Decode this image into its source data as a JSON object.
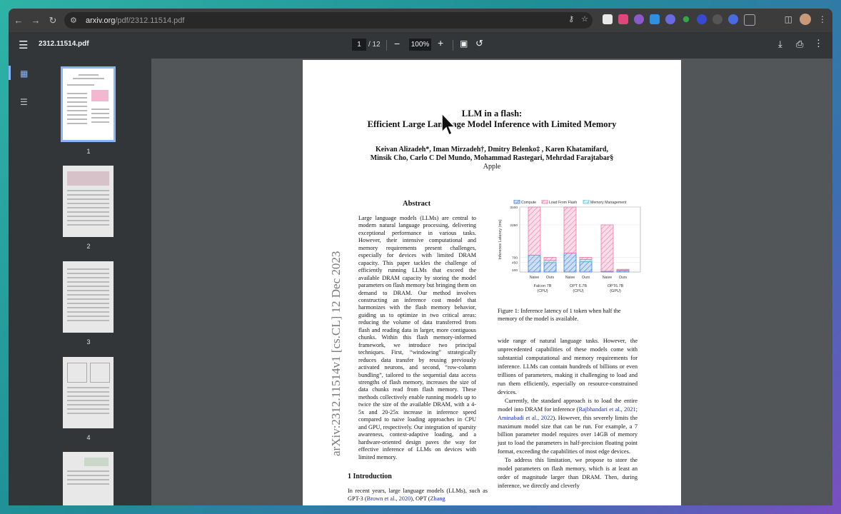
{
  "browser": {
    "url_host": "arxiv.org",
    "url_path": "/pdf/2312.11514.pdf",
    "back_icon": "arrow-left-icon",
    "forward_icon": "arrow-right-icon",
    "reload_icon": "reload-icon"
  },
  "toolbar": {
    "filename": "2312.11514.pdf",
    "page_current": "1",
    "page_total": "/ 12",
    "zoom": "100%"
  },
  "thumbnails": [
    "1",
    "2",
    "3",
    "4"
  ],
  "paper": {
    "title_1": "LLM in a flash:",
    "title_2": "Efficient Large Language Model Inference with Limited Memory",
    "authors_1": "Keivan Alizadeh*, Iman Mirzadeh†, Dmitry Belenko‡ , Karen Khatamifard,",
    "authors_2": "Minsik Cho, Carlo C Del Mundo, Mohammad Rastegari, Mehrdad Farajtabar§",
    "affiliation": "Apple",
    "arxiv_stamp": "arXiv:2312.11514v1 [cs.CL] 12 Dec 2023",
    "abstract_heading": "Abstract",
    "abstract": "Large language models (LLMs) are central to modern natural language processing, delivering exceptional performance in various tasks. However, their intensive computational and memory requirements present challenges, especially for devices with limited DRAM capacity. This paper tackles the challenge of efficiently running LLMs that exceed the available DRAM capacity by storing the model parameters on flash memory but bringing them on demand to DRAM. Our method involves constructing an inference cost model that harmonizes with the flash memory behavior, guiding us to optimize in two critical areas: reducing the volume of data transferred from flash and reading data in larger, more contiguous chunks. Within this flash memory-informed framework, we introduce two principal techniques. First, “windowing” strategically reduces data transfer by reusing previously activated neurons, and second, “row-column bundling”, tailored to the sequential data access strengths of flash memory, increases the size of data chunks read from flash memory. These methods collectively enable running models up to twice the size of the available DRAM, with a 4-5x and 20-25x increase in inference speed compared to naive loading approaches in CPU and GPU, respectively. Our integration of sparsity awareness, context-adaptive loading, and a hardware-oriented design paves the way for effective inference of LLMs on devices with limited memory.",
    "intro_heading": "1   Introduction",
    "intro_text_a": "In recent years, large language models (LLMs), such as GPT-3 (",
    "intro_cite_1": "Brown et al., 2020",
    "intro_text_b": "), OPT (",
    "intro_cite_2": "Zhang",
    "figure_caption": "Figure 1: Inference latency of 1 token when half the memory of the model is available.",
    "right_p1": "wide range of natural language tasks. However, the unprecedented capabilities of these models come with substantial computational and memory requirements for inference. LLMs can contain hundreds of billions or even trillions of parameters, making it challenging to load and run them efficiently, especially on resource-constrained devices.",
    "right_p2a": "Currently, the standard approach is to load the entire model into DRAM for inference (",
    "right_cite_1": "Rajbhandari et al., 2021",
    "right_p2b": "; ",
    "right_cite_2": "Aminabadi et al., 2022",
    "right_p2c": "). However, this severely limits the maximum model size that can be run. For example, a 7 billion parameter model requires over 14GB of memory just to load the parameters in half-precision floating point format, exceeding the capabilities of most edge devices.",
    "right_p3": "To address this limitation, we propose to store the model parameters on flash memory, which is at least an order of magnitude larger than DRAM. Then, during inference, we directly and cleverly"
  },
  "chart_data": {
    "type": "bar",
    "stacked": true,
    "ylabel": "Inference Latency (ms)",
    "yticks": [
      100,
      450,
      700,
      2250,
      3100
    ],
    "ylim": [
      0,
      3100
    ],
    "legend": [
      "Compute",
      "Load From Flash",
      "Memory Management"
    ],
    "legend_position": "top",
    "colors": {
      "compute": "#3d7fd0",
      "load": "#e87aa8",
      "memory": "#5cc6cf"
    },
    "groups": [
      {
        "label_1": "Falcon 7B",
        "label_2": "(CPU)"
      },
      {
        "label_1": "OPT 6.7B",
        "label_2": "(CPU)"
      },
      {
        "label_1": "OPT6.7B",
        "label_2": "(GPU)"
      }
    ],
    "bars": [
      {
        "label": "Naive",
        "group": 0,
        "compute": 800,
        "load": 2300,
        "memory": 0
      },
      {
        "label": "Ours",
        "group": 0,
        "compute": 450,
        "load": 150,
        "memory": 100
      },
      {
        "label": "Naive",
        "group": 1,
        "compute": 900,
        "load": 2200,
        "memory": 0
      },
      {
        "label": "Ours",
        "group": 1,
        "compute": 500,
        "load": 100,
        "memory": 100
      },
      {
        "label": "Naive",
        "group": 2,
        "compute": 30,
        "load": 2220,
        "memory": 0
      },
      {
        "label": "Ours",
        "group": 2,
        "compute": 60,
        "load": 40,
        "memory": 30
      }
    ]
  }
}
